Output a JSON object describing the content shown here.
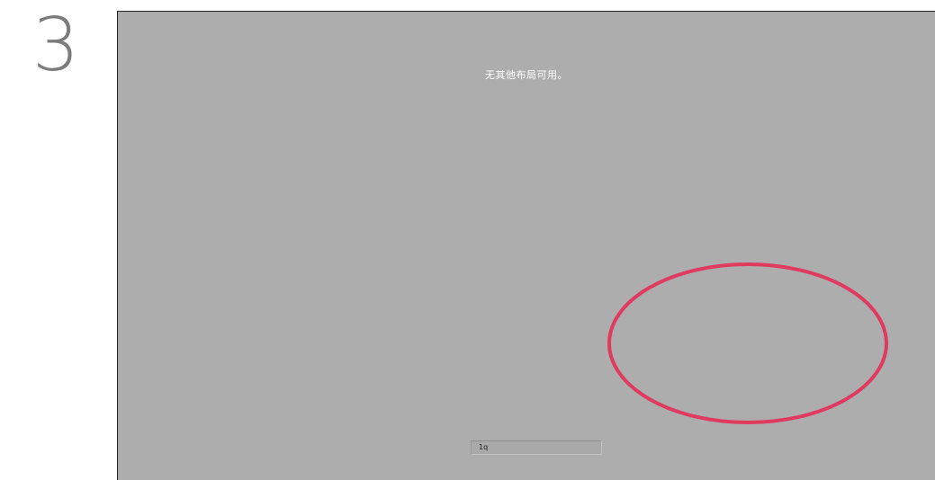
{
  "step": {
    "number": "3"
  },
  "screen": {
    "message": "无其他布局可用。",
    "bottom_field": {
      "value": "1q"
    }
  },
  "annotation": {
    "shape": "ellipse",
    "color": "#e03a5f"
  },
  "colors": {
    "screen_background": "#adadad",
    "step_number": "#7c7c7c",
    "message_text": "#ffffff"
  }
}
